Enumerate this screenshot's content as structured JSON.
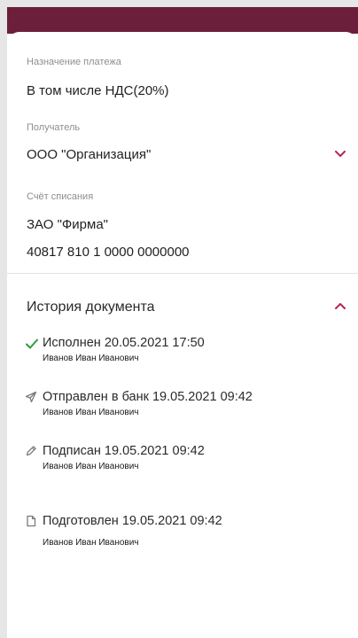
{
  "payment_purpose": {
    "label": "Назначение платежа",
    "value": "В том числе НДС(20%)"
  },
  "recipient": {
    "label": "Получатель",
    "value": "ООО \"Организация\""
  },
  "debit_account": {
    "label": "Счёт списания",
    "name": "ЗАО \"Фирма\"",
    "number": "40817 810 1 0000 0000000"
  },
  "history": {
    "title": "История документа",
    "items": [
      {
        "icon": "check-icon",
        "title": "Исполнен 20.05.2021 17:50",
        "user": "Иванов Иван Иванович"
      },
      {
        "icon": "send-icon",
        "title": "Отправлен в банк 19.05.2021 09:42",
        "user": "Иванов Иван Иванович"
      },
      {
        "icon": "pencil-icon",
        "title": "Подписан 19.05.2021 09:42",
        "user": "Иванов Иван Иванович"
      },
      {
        "icon": "document-icon",
        "title": "Подготовлен 19.05.2021 09:42",
        "user": "Иванов Иван Иванович"
      }
    ]
  },
  "colors": {
    "accent": "#b4264f",
    "success": "#2e9d3a",
    "header": "#6b1f3a",
    "icon_gray": "#7a7a7a"
  }
}
